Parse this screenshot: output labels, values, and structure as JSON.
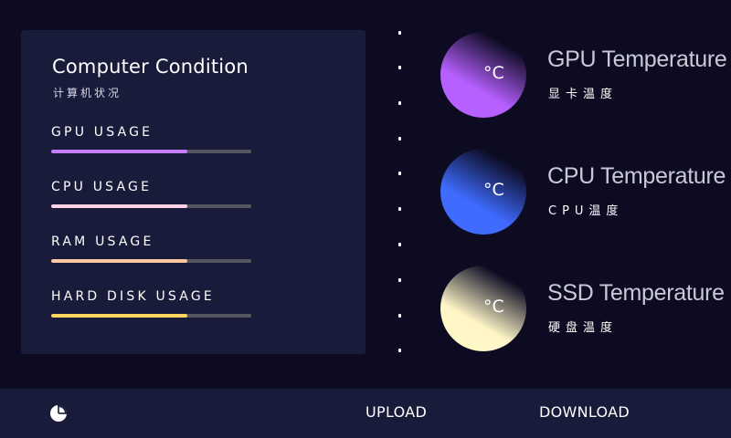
{
  "panel": {
    "title": "Computer Condition",
    "subtitle": "计算机状况",
    "metrics": [
      {
        "label": "GPU USAGE",
        "value": 0.68,
        "color": "#c77dff"
      },
      {
        "label": "CPU USAGE",
        "value": 0.68,
        "color": "#ffd4e8"
      },
      {
        "label": "RAM USAGE",
        "value": 0.68,
        "color": "#ffc8a0"
      },
      {
        "label": "HARD DISK USAGE",
        "value": 0.68,
        "color": "#ffd75e"
      }
    ]
  },
  "temperatures": [
    {
      "title": "GPU Temperature",
      "subtitle": "显卡温度",
      "unit": "°C",
      "color": "#b660ff"
    },
    {
      "title": "CPU Temperature",
      "subtitle": "CPU温度",
      "unit": "°C",
      "color": "#3f6cff"
    },
    {
      "title": "SSD Temperature",
      "subtitle": "硬盘温度",
      "unit": "°C",
      "color": "#fff6c8"
    }
  ],
  "bottombar": {
    "icon": "pie-chart-icon",
    "upload_label": "UPLOAD",
    "download_label": "DOWNLOAD"
  },
  "colors": {
    "background": "#0c0b22",
    "panel": "#181b3a",
    "track": "#55575e"
  }
}
